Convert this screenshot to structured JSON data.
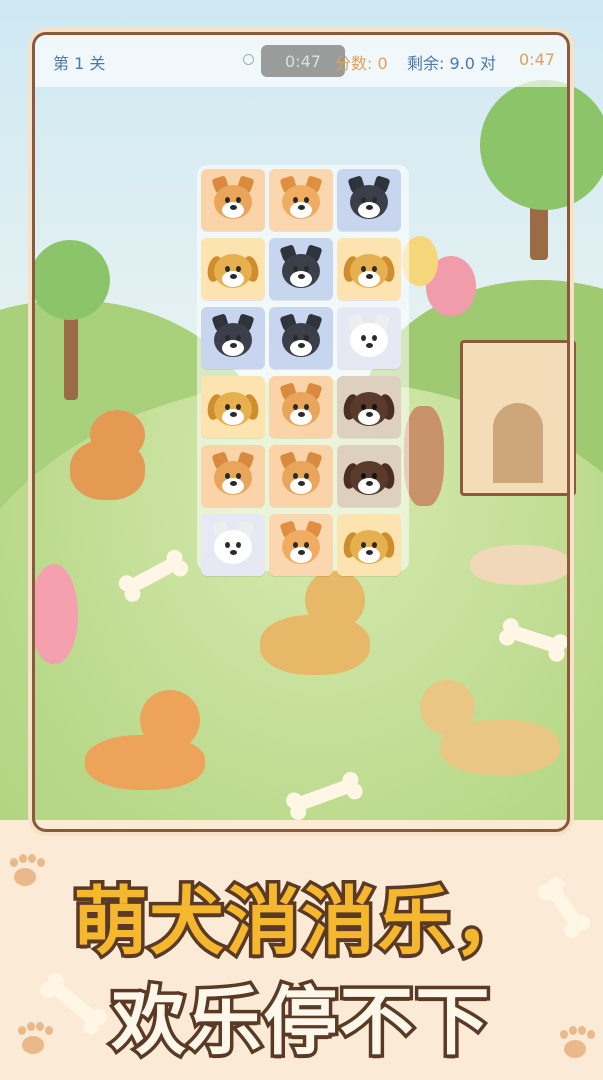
{
  "hud": {
    "level": "第 1 关",
    "timer_pill": "0:47",
    "score": "分数: 0",
    "remaining": "剩余: 9.0 对",
    "timer": "0:47"
  },
  "colors": {
    "frame_border": "#8a5a3a",
    "headline_fill": "#f5b72e",
    "headline_stroke": "#5a3a24",
    "hud_blue": "#4a7aa8",
    "hud_orange": "#e0a05a"
  },
  "board": {
    "columns": 3,
    "rows": [
      [
        "shiba",
        "corgi",
        "husky"
      ],
      [
        "golden",
        "husky",
        "golden"
      ],
      [
        "husky",
        "husky",
        "samoyed"
      ],
      [
        "golden",
        "shiba",
        "labrador"
      ],
      [
        "shiba",
        "shiba",
        "labrador"
      ],
      [
        "samoyed",
        "corgi",
        "golden"
      ]
    ]
  },
  "breeds": {
    "shiba": {
      "icon": "shiba-dog-icon",
      "face": "#e9a55a",
      "ear": "#d98a3e",
      "tile": "#fbd3a8",
      "ears": "pointy"
    },
    "corgi": {
      "icon": "corgi-dog-icon",
      "face": "#f0ad62",
      "ear": "#e08f40",
      "tile": "#fbd7b0",
      "ears": "pointy"
    },
    "husky": {
      "icon": "husky-dog-icon",
      "face": "#3a3f4a",
      "ear": "#2f333c",
      "tile": "#c7d6ee",
      "ears": "pointy"
    },
    "golden": {
      "icon": "golden-retriever-icon",
      "face": "#e6b04f",
      "ear": "#cf8e2e",
      "tile": "#fde3b0",
      "ears": "floppy"
    },
    "samoyed": {
      "icon": "samoyed-dog-icon",
      "face": "#ffffff",
      "ear": "#eeeeee",
      "tile": "#e6e8f4",
      "ears": "pointy"
    },
    "labrador": {
      "icon": "labrador-dog-icon",
      "face": "#5a3a2a",
      "ear": "#4a2e20",
      "tile": "#ddd0bf",
      "ears": "floppy"
    }
  },
  "headline": {
    "line1": "萌犬消消乐，",
    "line2": "欢乐停不下"
  }
}
